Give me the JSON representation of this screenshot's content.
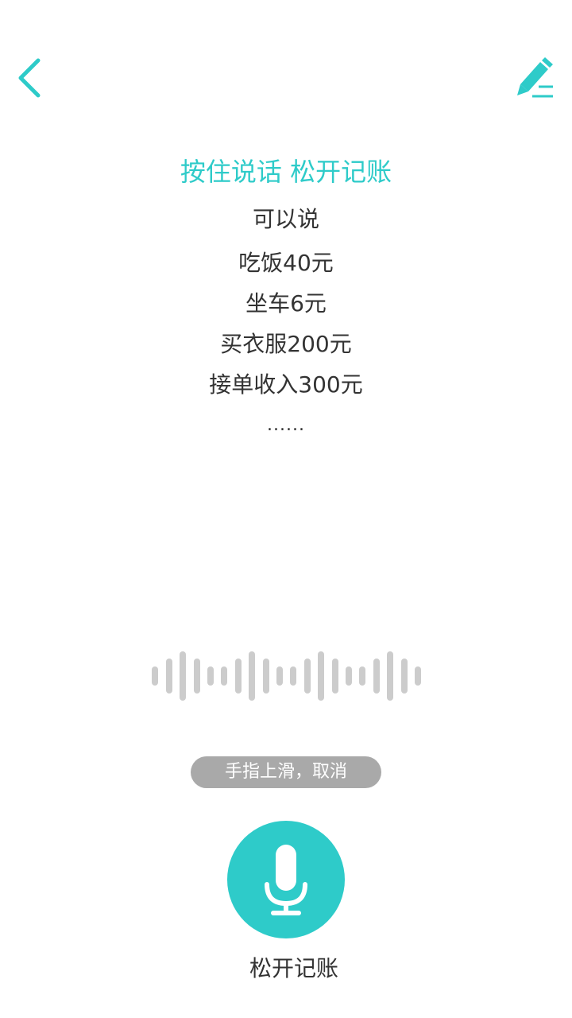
{
  "header": {
    "back_icon": "chevron-left-icon",
    "edit_icon": "pencil-icon"
  },
  "instructions": {
    "headline": "按住说话 松开记账",
    "hint_label": "可以说",
    "examples": [
      "吃饭40元",
      "坐车6元",
      "买衣服200元",
      "接单收入300元"
    ],
    "ellipsis": "......"
  },
  "recorder": {
    "cancel_hint": "手指上滑，取消",
    "release_label": "松开记账",
    "mic_icon": "microphone-icon"
  },
  "colors": {
    "accent": "#2ecbc9",
    "text": "#333333",
    "pill_bg": "#a9a9a9",
    "wave_bar": "#cccccc"
  }
}
